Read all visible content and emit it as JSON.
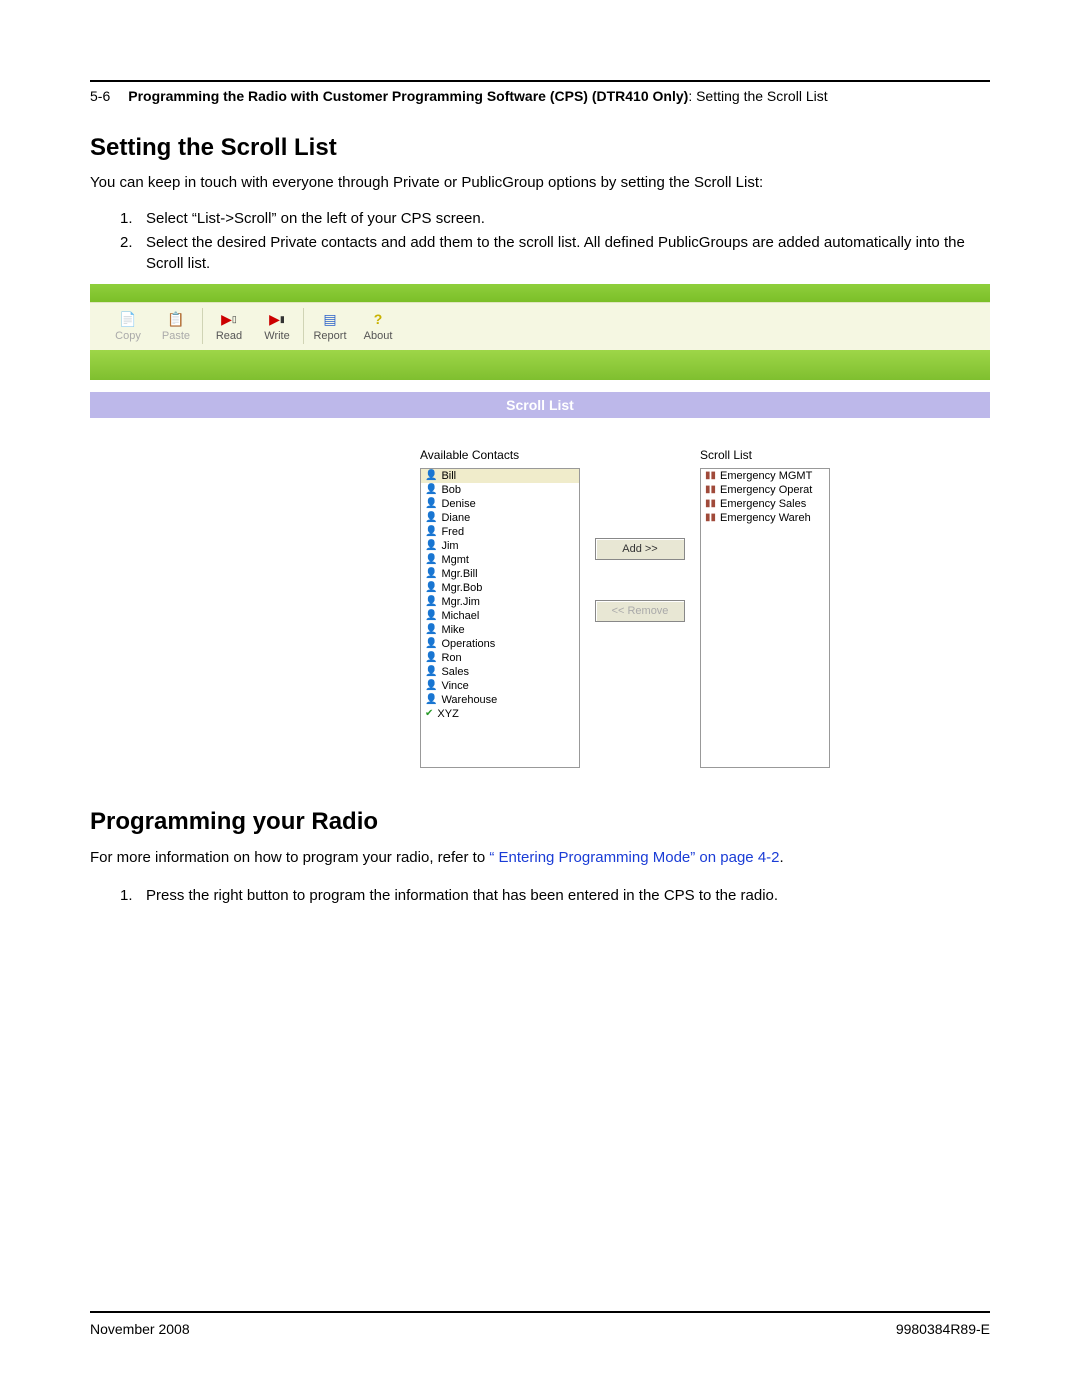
{
  "header": {
    "page_number": "5-6",
    "title_bold": "Programming the Radio with Customer Programming Software (CPS) (DTR410 Only)",
    "title_rest": ": Setting the Scroll List"
  },
  "section1": {
    "heading": "Setting the Scroll List",
    "intro": "You can keep in touch with everyone through Private or PublicGroup options by setting the Scroll List:",
    "steps": [
      "Select “List->Scroll” on the left of your CPS screen.",
      "Select the desired Private contacts and add them to the scroll list. All defined PublicGroups are added automatically into the Scroll list."
    ]
  },
  "cps": {
    "toolbar": {
      "copy": "Copy",
      "paste": "Paste",
      "read": "Read",
      "write": "Write",
      "report": "Report",
      "about": "About"
    },
    "panel_title": "Scroll List",
    "available_label": "Available Contacts",
    "scroll_label": "Scroll List",
    "add_btn": "Add >>",
    "remove_btn": "<< Remove",
    "available_contacts": [
      "Bill",
      "Bob",
      "Denise",
      "Diane",
      "Fred",
      "Jim",
      "Mgmt",
      "Mgr.Bill",
      "Mgr.Bob",
      "Mgr.Jim",
      "Michael",
      "Mike",
      "Operations",
      "Ron",
      "Sales",
      "Vince",
      "Warehouse",
      "XYZ"
    ],
    "scroll_items": [
      "Emergency MGMT",
      "Emergency Operat",
      "Emergency Sales",
      "Emergency Wareh"
    ]
  },
  "section2": {
    "heading": "Programming your Radio",
    "para_pre": "For more information on how to program your radio, refer to ",
    "para_link": "“ Entering Programming Mode” on page 4-2",
    "para_post": ".",
    "steps": [
      "Press the right button to program the information that has been entered in the CPS to the radio."
    ]
  },
  "footer": {
    "left": "November 2008",
    "right": "9980384R89-E"
  }
}
